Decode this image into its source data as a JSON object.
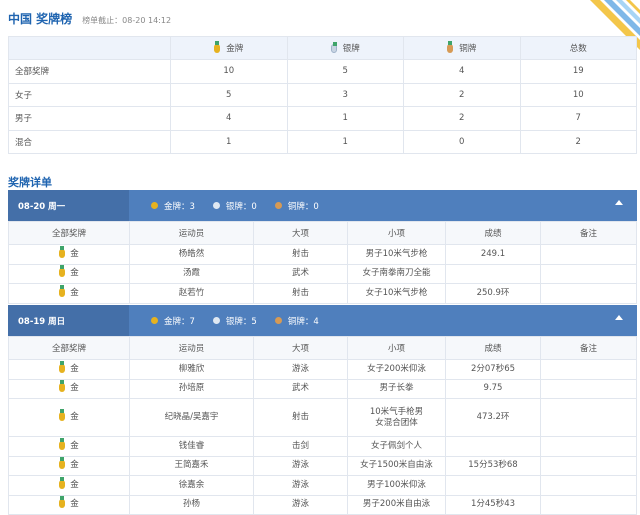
{
  "header": {
    "title": "中国 奖牌榜",
    "subtitle": "榜单截止：08-20 14:12"
  },
  "summary": {
    "columns": [
      "",
      "金牌",
      "银牌",
      "铜牌",
      "总数"
    ],
    "rows": [
      {
        "label": "全部奖牌",
        "gold": "10",
        "silver": "5",
        "bronze": "4",
        "total": "19"
      },
      {
        "label": "女子",
        "gold": "5",
        "silver": "3",
        "bronze": "2",
        "total": "10"
      },
      {
        "label": "男子",
        "gold": "4",
        "silver": "1",
        "bronze": "2",
        "total": "7"
      },
      {
        "label": "混合",
        "gold": "1",
        "silver": "1",
        "bronze": "0",
        "total": "2"
      }
    ]
  },
  "details_title": "奖牌详单",
  "detail_columns": [
    "全部奖牌",
    "运动员",
    "大项",
    "小项",
    "成绩",
    "备注"
  ],
  "days": [
    {
      "date": "08-20 周一",
      "gold_count": "金牌：3",
      "silver_count": "银牌：0",
      "bronze_count": "铜牌：0",
      "rows": [
        {
          "medal": "金",
          "athlete": "杨皓然",
          "sport": "射击",
          "event": "男子10米气步枪",
          "result": "249.1",
          "note": ""
        },
        {
          "medal": "金",
          "athlete": "汤霞",
          "sport": "武术",
          "event": "女子南拳南刀全能",
          "result": "",
          "note": ""
        },
        {
          "medal": "金",
          "athlete": "赵若竹",
          "sport": "射击",
          "event": "女子10米气步枪",
          "result": "250.9环",
          "note": ""
        }
      ]
    },
    {
      "date": "08-19 周日",
      "gold_count": "金牌：7",
      "silver_count": "银牌：5",
      "bronze_count": "铜牌：4",
      "rows": [
        {
          "medal": "金",
          "athlete": "柳雅欣",
          "sport": "游泳",
          "event": "女子200米仰泳",
          "result": "2分07秒65",
          "note": ""
        },
        {
          "medal": "金",
          "athlete": "孙培原",
          "sport": "武术",
          "event": "男子长拳",
          "result": "9.75",
          "note": ""
        },
        {
          "medal": "金",
          "athlete": "纪晓晶/吴嘉宇",
          "sport": "射击",
          "event": "10米气手枪男女混合团体",
          "result": "473.2环",
          "note": ""
        },
        {
          "medal": "金",
          "athlete": "钱佳睿",
          "sport": "击剑",
          "event": "女子佩剑个人",
          "result": "",
          "note": ""
        },
        {
          "medal": "金",
          "athlete": "王简嘉禾",
          "sport": "游泳",
          "event": "女子1500米自由泳",
          "result": "15分53秒68",
          "note": ""
        },
        {
          "medal": "金",
          "athlete": "徐嘉余",
          "sport": "游泳",
          "event": "男子100米仰泳",
          "result": "",
          "note": ""
        },
        {
          "medal": "金",
          "athlete": "孙杨",
          "sport": "游泳",
          "event": "男子200米自由泳",
          "result": "1分45秒43",
          "note": ""
        }
      ]
    }
  ]
}
